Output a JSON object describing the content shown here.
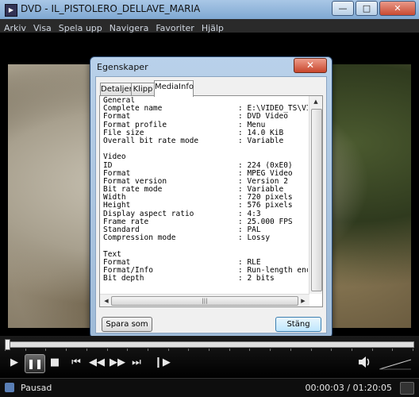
{
  "window": {
    "title": "DVD - IL_PISTOLERO_DELLAVE_MARIA",
    "minimize_label": "—",
    "maximize_label": "□",
    "close_label": "✕"
  },
  "menu": [
    "Arkiv",
    "Visa",
    "Spela upp",
    "Navigera",
    "Favoriter",
    "Hjälp"
  ],
  "dialog": {
    "title": "Egenskaper",
    "close_label": "✕",
    "tabs": [
      "Detaljer",
      "Klipp",
      "MediaInfo"
    ],
    "active_tab": "MediaInfo",
    "mediainfo": [
      {
        "key": "General",
        "value": ""
      },
      {
        "key": "Complete name",
        "value": ": E:\\VIDEO_TS\\VID"
      },
      {
        "key": "Format",
        "value": ": DVD Video"
      },
      {
        "key": "Format profile",
        "value": ": Menu"
      },
      {
        "key": "File size",
        "value": ": 14.0 KiB"
      },
      {
        "key": "Overall bit rate mode",
        "value": ": Variable"
      },
      {
        "key": "",
        "value": ""
      },
      {
        "key": "Video",
        "value": ""
      },
      {
        "key": "ID",
        "value": ": 224 (0xE0)"
      },
      {
        "key": "Format",
        "value": ": MPEG Video"
      },
      {
        "key": "Format version",
        "value": ": Version 2"
      },
      {
        "key": "Bit rate mode",
        "value": ": Variable"
      },
      {
        "key": "Width",
        "value": ": 720 pixels"
      },
      {
        "key": "Height",
        "value": ": 576 pixels"
      },
      {
        "key": "Display aspect ratio",
        "value": ": 4:3"
      },
      {
        "key": "Frame rate",
        "value": ": 25.000 FPS"
      },
      {
        "key": "Standard",
        "value": ": PAL"
      },
      {
        "key": "Compression mode",
        "value": ": Lossy"
      },
      {
        "key": "",
        "value": ""
      },
      {
        "key": "Text",
        "value": ""
      },
      {
        "key": "Format",
        "value": ": RLE"
      },
      {
        "key": "Format/Info",
        "value": ": Run-length enco"
      },
      {
        "key": "Bit depth",
        "value": ": 2 bits"
      }
    ],
    "save_button": "Spara som",
    "close_button": "Stäng"
  },
  "player": {
    "status": "Pausad",
    "time": "00:00:03 / 01:20:05",
    "progress_fraction": 0.0006
  }
}
